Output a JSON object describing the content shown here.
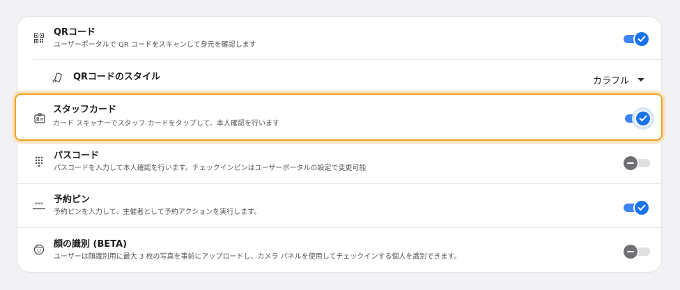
{
  "settings": {
    "qr_code": {
      "title": "QRコード",
      "description": "ユーザーポータルで QR コードをスキャンして身元を確認します",
      "enabled": true
    },
    "qr_style": {
      "title": "QRコードのスタイル",
      "selected": "カラフル"
    },
    "staff_card": {
      "title": "スタッフカード",
      "description": "カード スキャナーでスタッフ カードをタップして、本人確認を行います",
      "enabled": true
    },
    "passcode": {
      "title": "パスコード",
      "description": "パスコードを入力して本人確認を行います。チェックインピンはユーザーポータルの設定で変更可能",
      "enabled": false
    },
    "booking_pin": {
      "title": "予約ピン",
      "description": "予約ピンを入力して、主催者として予約アクションを実行します。",
      "enabled": true
    },
    "face_id": {
      "title": "顔の識別 (BETA)",
      "description": "ユーザーは顔識別用に最大 3 枚の写真を事前にアップロードし、カメラ パネルを使用してチェックインする個人を識別できます。",
      "enabled": false
    }
  },
  "colors": {
    "accent": "#1a73e8",
    "highlight": "#f0a020"
  }
}
